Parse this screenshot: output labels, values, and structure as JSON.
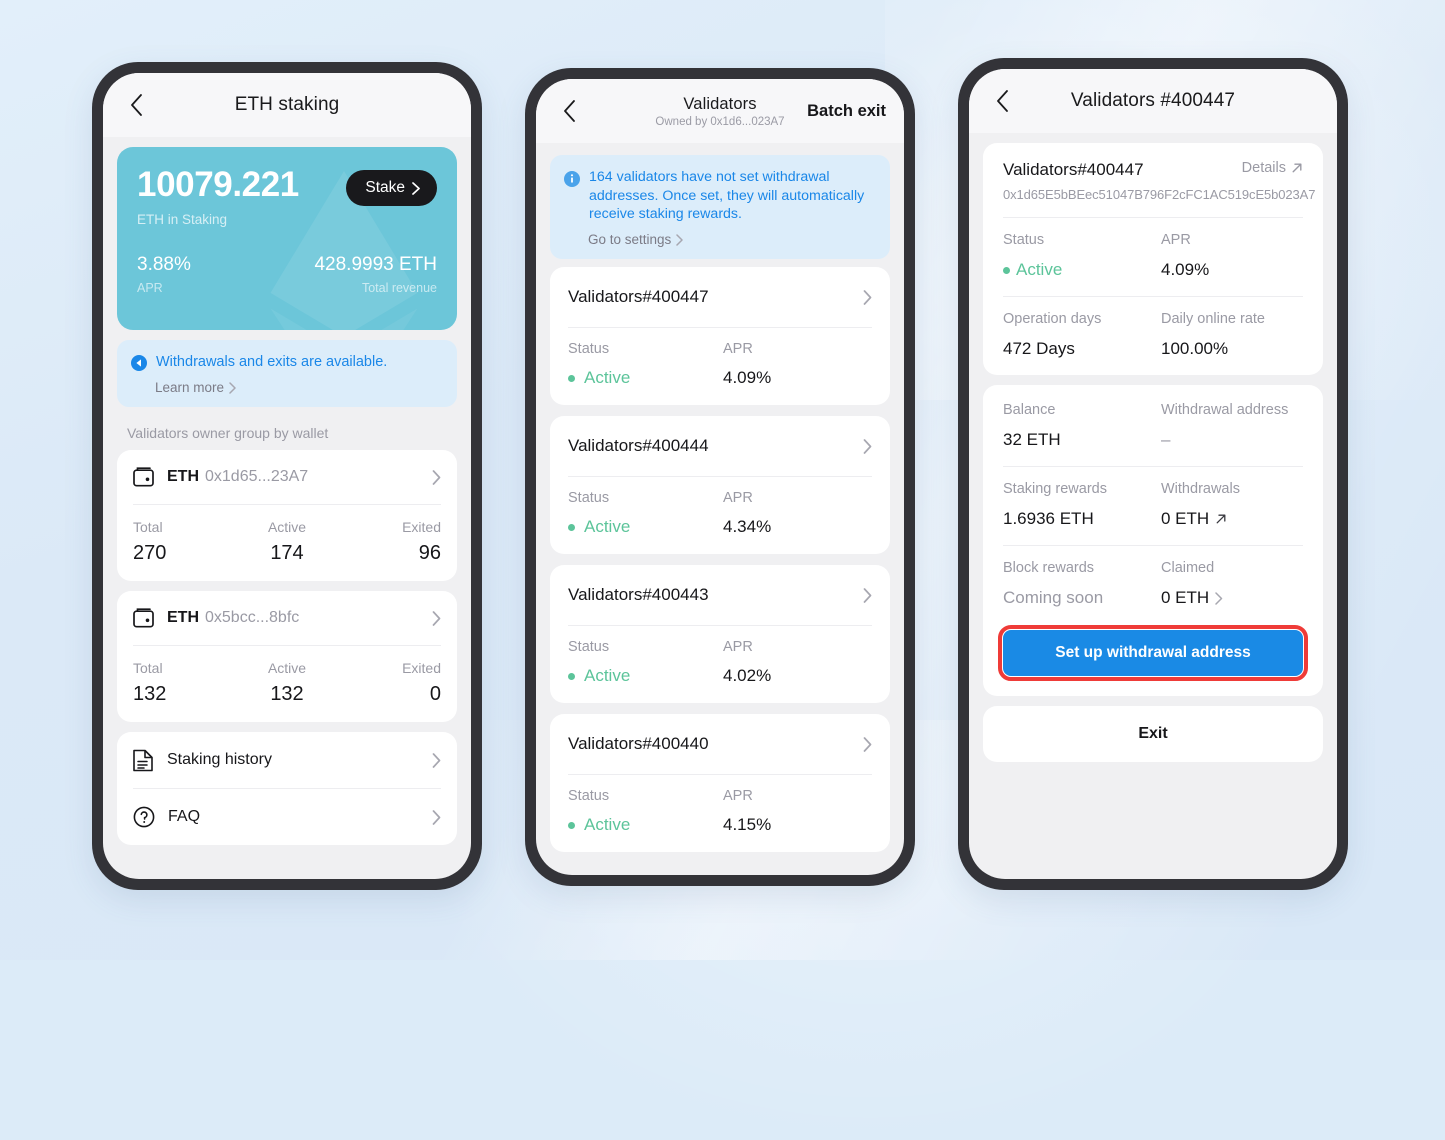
{
  "colors": {
    "backdrop": "#dcebf8",
    "teal_card": "#6cc6d9",
    "accent_blue": "#1a8ae5",
    "banner_blue_text": "#1a87e8",
    "active_green": "#5cc49a",
    "highlight_red": "#ef3b38",
    "dark_button": "#19191c"
  },
  "phone1": {
    "nav": {
      "back_icon": "chevron-left-icon",
      "title": "ETH staking"
    },
    "hero": {
      "amount": "10079.221",
      "amount_label": "ETH in Staking",
      "stake_button": "Stake",
      "apr_value": "3.88%",
      "apr_label": "APR",
      "revenue_value": "428.9993 ETH",
      "revenue_label": "Total revenue"
    },
    "banner": {
      "icon": "info-circle-icon",
      "text": "Withdrawals and exits are available.",
      "link": "Learn more"
    },
    "section_label": "Validators owner group by wallet",
    "wallets": [
      {
        "icon": "wallet-icon",
        "chain": "ETH",
        "address": "0x1d65...23A7",
        "stats": [
          {
            "key": "Total",
            "value": "270"
          },
          {
            "key": "Active",
            "value": "174"
          },
          {
            "key": "Exited",
            "value": "96"
          }
        ]
      },
      {
        "icon": "wallet-icon",
        "chain": "ETH",
        "address": "0x5bcc...8bfc",
        "stats": [
          {
            "key": "Total",
            "value": "132"
          },
          {
            "key": "Active",
            "value": "132"
          },
          {
            "key": "Exited",
            "value": "0"
          }
        ]
      }
    ],
    "menu": [
      {
        "icon": "document-icon",
        "label": "Staking history"
      },
      {
        "icon": "question-circle-icon",
        "label": "FAQ"
      }
    ]
  },
  "phone2": {
    "nav": {
      "back_icon": "chevron-left-icon",
      "title": "Validators",
      "subtitle": "Owned by 0x1d6...023A7",
      "action": "Batch exit"
    },
    "banner": {
      "icon": "info-circle-icon",
      "text": "164 validators have not set withdrawal addresses. Once set, they will automatically receive staking rewards.",
      "link": "Go to settings"
    },
    "validators": [
      {
        "title": "Validators",
        "id": "#400447",
        "status_key": "Status",
        "status": "Active",
        "apr_key": "APR",
        "apr": "4.09%"
      },
      {
        "title": "Validators",
        "id": "#400444",
        "status_key": "Status",
        "status": "Active",
        "apr_key": "APR",
        "apr": "4.34%"
      },
      {
        "title": "Validators",
        "id": "#400443",
        "status_key": "Status",
        "status": "Active",
        "apr_key": "APR",
        "apr": "4.02%"
      },
      {
        "title": "Validators",
        "id": "#400440",
        "status_key": "Status",
        "status": "Active",
        "apr_key": "APR",
        "apr": "4.15%"
      }
    ]
  },
  "phone3": {
    "nav": {
      "back_icon": "chevron-left-icon",
      "title": "Validators #400447"
    },
    "detail": {
      "title": "Validators",
      "id": "#400447",
      "details_link": "Details",
      "address": "0x1d65E5bBEec51047B796F2cFC1AC519cE5b023A7",
      "status_key": "Status",
      "status": "Active",
      "apr_key": "APR",
      "apr": "4.09%",
      "operation_days_key": "Operation days",
      "operation_days": "472 Days",
      "daily_online_key": "Daily online rate",
      "daily_online": "100.00%"
    },
    "finance": {
      "balance_key": "Balance",
      "balance": "32 ETH",
      "withdrawal_address_key": "Withdrawal address",
      "withdrawal_address": "–",
      "staking_rewards_key": "Staking rewards",
      "staking_rewards": "1.6936 ETH",
      "withdrawals_key": "Withdrawals",
      "withdrawals": "0 ETH",
      "block_rewards_key": "Block rewards",
      "block_rewards": "Coming soon",
      "claimed_key": "Claimed",
      "claimed": "0 ETH",
      "primary_button": "Set up withdrawal address"
    },
    "exit_button": "Exit"
  }
}
